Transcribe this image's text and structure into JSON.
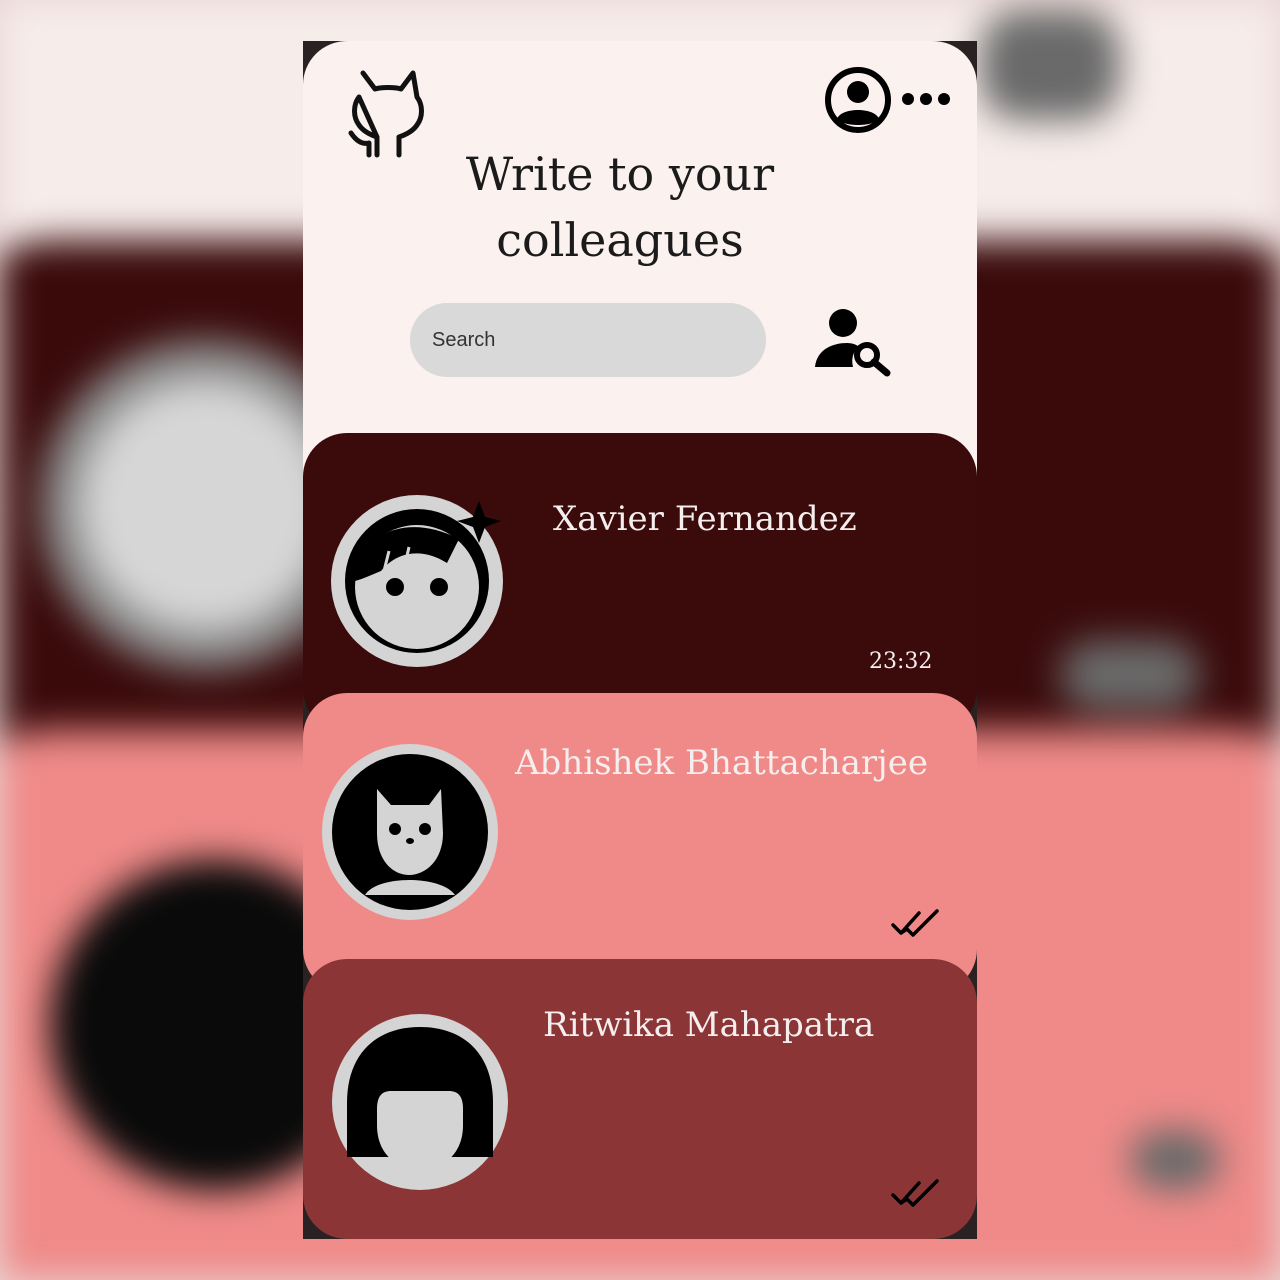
{
  "header": {
    "title_line1": "Write to your",
    "title_line2": "colleagues",
    "logo_icon": "github-octocat-outline-icon",
    "profile_icon": "user-circle-icon",
    "more_icon": "more-horizontal-icon"
  },
  "search": {
    "placeholder": "Search",
    "action_icon": "user-search-icon"
  },
  "chats": [
    {
      "name": "Xavier  Fernandez",
      "time": "23:32",
      "avatar_icon": "boy-face-avatar-icon",
      "status": ""
    },
    {
      "name": "Abhishek Bhattacharjee",
      "time": "",
      "avatar_icon": "cat-avatar-icon",
      "status": "read-double-check-icon"
    },
    {
      "name": "Ritwika Mahapatra",
      "time": "",
      "avatar_icon": "girl-avatar-icon",
      "status": "read-double-check-icon"
    }
  ],
  "colors": {
    "header_bg": "#fbf1ef",
    "chat1_bg": "#3b0a0b",
    "chat2_bg": "#f08a88",
    "chat3_bg": "#8b3536",
    "search_bg": "#d9d9d9"
  }
}
